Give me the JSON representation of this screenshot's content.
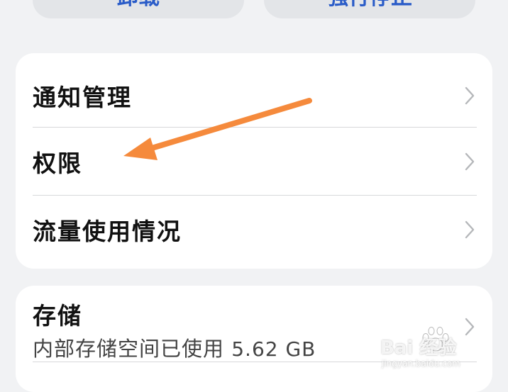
{
  "top_buttons": [
    {
      "label": "卸载"
    },
    {
      "label": "强行停止"
    }
  ],
  "settings": {
    "items": [
      {
        "label": "通知管理"
      },
      {
        "label": "权限"
      },
      {
        "label": "流量使用情况"
      }
    ]
  },
  "storage": {
    "title": "存储",
    "subtitle_prefix": "内部存储空间已使用",
    "subtitle_value": "5.62 GB"
  },
  "colors": {
    "background": "#f1f2f4",
    "card": "#ffffff",
    "accent_blue": "#2a5cc8",
    "annotation_arrow": "#f58a3c",
    "chevron": "#b5b7ba"
  },
  "icons": {
    "row_chevron": "chevron-right-icon",
    "annotation": "arrow-left-icon"
  },
  "watermark": {
    "main": "Bai 经验",
    "sub": "jingyan.baidu.com"
  }
}
